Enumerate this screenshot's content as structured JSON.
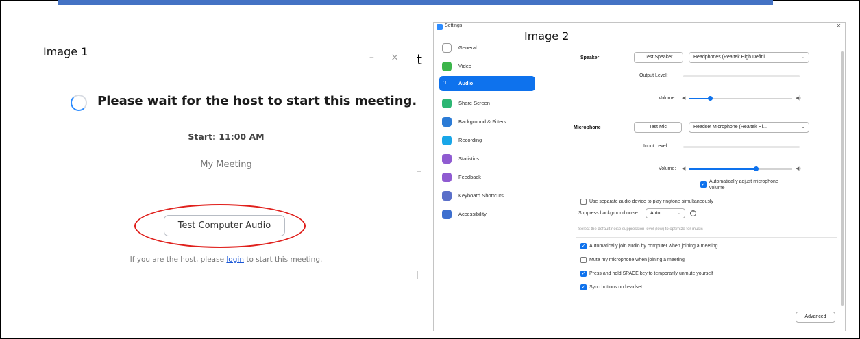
{
  "image1": {
    "label": "Image 1",
    "window_controls": "– ×",
    "edge_char": "t",
    "wait_message": "Please wait for the host to start this meeting.",
    "start_time": "Start: 11:00 AM",
    "meeting_name": "My Meeting",
    "test_audio_button": "Test Computer Audio",
    "host_prefix": "If you are the host, please ",
    "login_link": "login",
    "host_suffix": " to start this meeting.",
    "highlight_color": "#e0201c"
  },
  "image2": {
    "label": "Image 2",
    "window_title": "Settings",
    "close": "×",
    "sidebar": [
      {
        "label": "General",
        "icon": "gear-icon",
        "color": "#ffffff",
        "border": "#999999"
      },
      {
        "label": "Video",
        "icon": "video-icon",
        "color": "#3cb54a"
      },
      {
        "label": "Audio",
        "icon": "headphones-icon",
        "color": "#0e72ed",
        "active": true
      },
      {
        "label": "Share Screen",
        "icon": "share-screen-icon",
        "color": "#2cb673"
      },
      {
        "label": "Background & Filters",
        "icon": "background-icon",
        "color": "#2b7bd6"
      },
      {
        "label": "Recording",
        "icon": "recording-icon",
        "color": "#19a6e8"
      },
      {
        "label": "Statistics",
        "icon": "statistics-icon",
        "color": "#8f5bd1"
      },
      {
        "label": "Feedback",
        "icon": "feedback-icon",
        "color": "#8f5bd1"
      },
      {
        "label": "Keyboard Shortcuts",
        "icon": "keyboard-icon",
        "color": "#5a6fc9"
      },
      {
        "label": "Accessibility",
        "icon": "accessibility-icon",
        "color": "#3d6fcf"
      }
    ],
    "speaker": {
      "label": "Speaker",
      "test_button": "Test Speaker",
      "device": "Headphones (Realtek High Defini...",
      "output_level_label": "Output Level:",
      "volume_label": "Volume:",
      "volume": 0.2
    },
    "microphone": {
      "label": "Microphone",
      "test_button": "Test Mic",
      "device": "Headset Microphone (Realtek Hi...",
      "input_level_label": "Input Level:",
      "volume_label": "Volume:",
      "volume": 0.65,
      "auto_adjust_line1": "Automatically adjust microphone",
      "auto_adjust_line2": "volume"
    },
    "options": {
      "separate_device": "Use separate audio device to play ringtone simultaneously",
      "suppress_label": "Suppress background noise",
      "suppress_value": "Auto",
      "suppress_hint": "Select the default noise suppression level (low) to optimize for music",
      "join_audio": "Automatically join audio by computer when joining a meeting",
      "mute_mic": "Mute my microphone when joining a meeting",
      "space_key": "Press and hold SPACE key to temporarily unmute yourself",
      "sync_headset": "Sync buttons on headset"
    },
    "advanced_button": "Advanced",
    "accent_color": "#0e72ed"
  }
}
